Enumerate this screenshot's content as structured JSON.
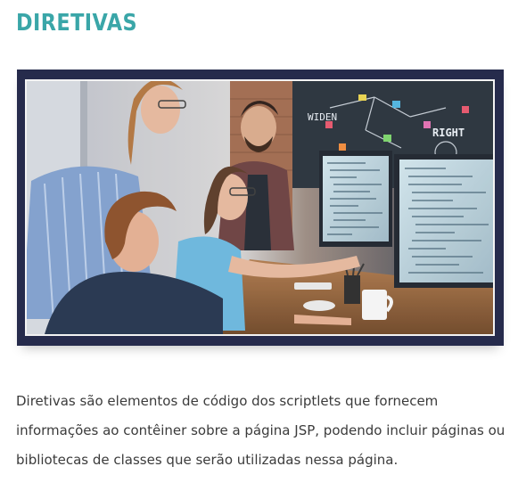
{
  "section": {
    "title": "DIRETIVAS",
    "title_color": "#3aa6a8"
  },
  "figure": {
    "frame_background": "#262b4c",
    "board_words": [
      "WIDEN",
      "RIGHT"
    ]
  },
  "body": {
    "paragraph": "Diretivas são elementos de código dos scriptlets que fornecem informações ao contêiner sobre a página JSP, podendo incluir páginas ou bibliotecas de classes que serão utilizadas nessa página."
  }
}
